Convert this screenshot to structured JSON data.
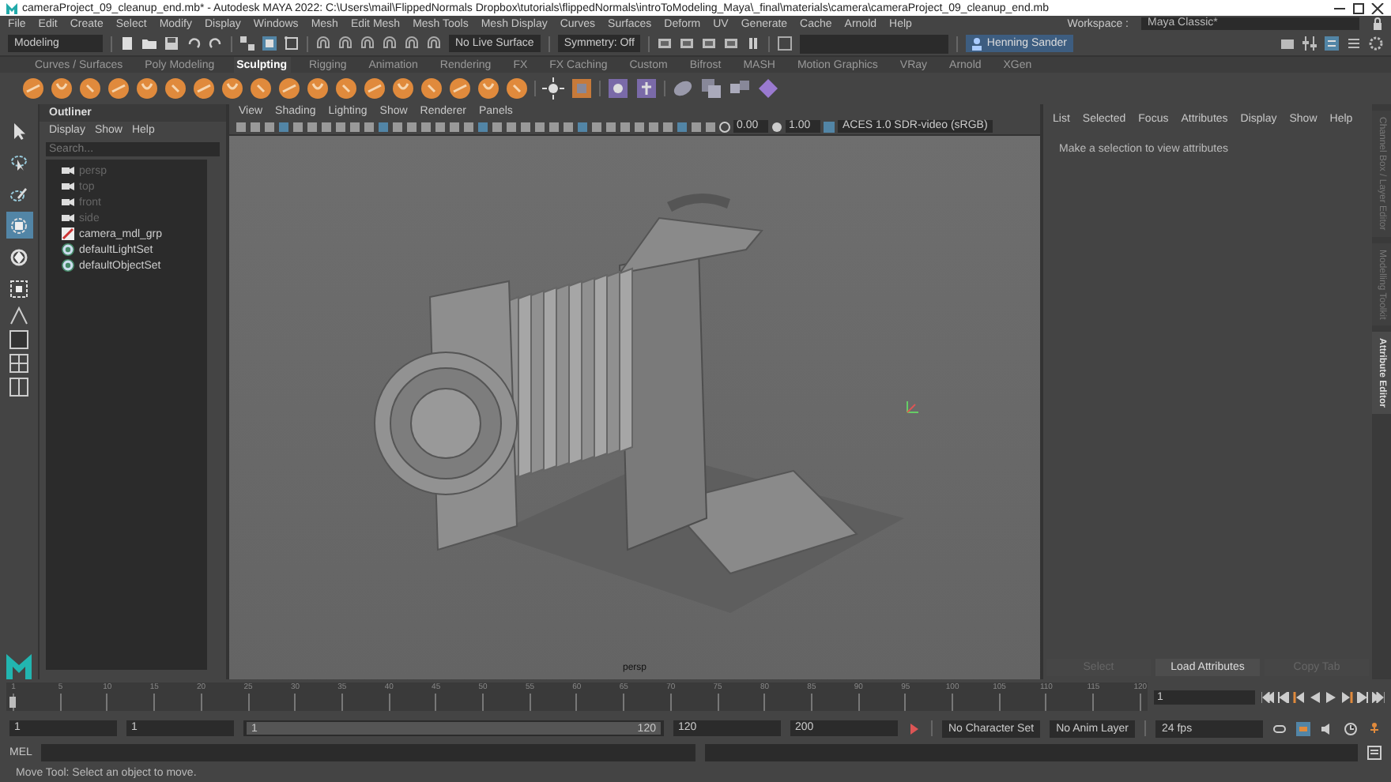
{
  "window": {
    "title": "cameraProject_09_cleanup_end.mb* - Autodesk MAYA 2022: C:\\Users\\mail\\FlippedNormals Dropbox\\tutorials\\flippedNormals\\introToModeling_Maya\\_final\\materials\\camera\\cameraProject_09_cleanup_end.mb"
  },
  "menu_bar": [
    "File",
    "Edit",
    "Create",
    "Select",
    "Modify",
    "Display",
    "Windows",
    "Mesh",
    "Edit Mesh",
    "Mesh Tools",
    "Mesh Display",
    "Curves",
    "Surfaces",
    "Deform",
    "UV",
    "Generate",
    "Cache",
    "Arnold",
    "Help"
  ],
  "workspace": {
    "label": "Workspace :",
    "value": "Maya Classic*"
  },
  "status_line": {
    "menu_set": "Modeling",
    "live_surface": "No Live Surface",
    "symmetry": "Symmetry: Off",
    "user": "Henning Sander"
  },
  "shelf_tabs": [
    {
      "label": "Curves / Surfaces",
      "selected": false
    },
    {
      "label": "Poly Modeling",
      "selected": false
    },
    {
      "label": "Sculpting",
      "selected": true
    },
    {
      "label": "Rigging",
      "selected": false
    },
    {
      "label": "Animation",
      "selected": false
    },
    {
      "label": "Rendering",
      "selected": false
    },
    {
      "label": "FX",
      "selected": false
    },
    {
      "label": "FX Caching",
      "selected": false
    },
    {
      "label": "Custom",
      "selected": false
    },
    {
      "label": "Bifrost",
      "selected": false
    },
    {
      "label": "MASH",
      "selected": false
    },
    {
      "label": "Motion Graphics",
      "selected": false
    },
    {
      "label": "VRay",
      "selected": false
    },
    {
      "label": "Arnold",
      "selected": false
    },
    {
      "label": "XGen",
      "selected": false
    }
  ],
  "toolbox": [
    {
      "kind": "select",
      "selected": false
    },
    {
      "kind": "lasso",
      "selected": false
    },
    {
      "kind": "paint",
      "selected": false
    },
    {
      "kind": "move",
      "selected": true
    },
    {
      "kind": "rotate",
      "selected": false
    },
    {
      "kind": "scale",
      "selected": false
    }
  ],
  "outliner": {
    "title": "Outliner",
    "menus": [
      "Display",
      "Show",
      "Help"
    ],
    "search": {
      "placeholder": "Search..."
    },
    "items": [
      {
        "kind": "camera",
        "label": "persp",
        "hidden": true
      },
      {
        "kind": "camera",
        "label": "top",
        "hidden": true
      },
      {
        "kind": "camera",
        "label": "front",
        "hidden": true
      },
      {
        "kind": "camera",
        "label": "side",
        "hidden": true
      },
      {
        "kind": "group",
        "label": "camera_mdl_grp",
        "hidden": false
      },
      {
        "kind": "set",
        "label": "defaultLightSet",
        "hidden": false
      },
      {
        "kind": "set",
        "label": "defaultObjectSet",
        "hidden": false
      }
    ]
  },
  "viewport": {
    "menus": [
      "View",
      "Shading",
      "Lighting",
      "Show",
      "Renderer",
      "Panels"
    ],
    "exposure": "0.00",
    "gamma": "1.00",
    "color_space": "ACES 1.0 SDR-video (sRGB)",
    "camera_label": "persp"
  },
  "attribute_editor": {
    "menus": [
      "List",
      "Selected",
      "Focus",
      "Attributes",
      "Display",
      "Show",
      "Help"
    ],
    "message": "Make a selection to view attributes",
    "buttons": [
      {
        "label": "Select",
        "disabled": true
      },
      {
        "label": "Load Attributes",
        "disabled": false
      },
      {
        "label": "Copy Tab",
        "disabled": true
      }
    ],
    "side_tabs": [
      {
        "label": "Channel Box / Layer Editor",
        "selected": false
      },
      {
        "label": "Modelling Toolkit",
        "selected": false
      },
      {
        "label": "Attribute Editor",
        "selected": true
      }
    ]
  },
  "timeline": {
    "ticks": [
      "1",
      "5",
      "10",
      "15",
      "20",
      "25",
      "30",
      "35",
      "40",
      "45",
      "50",
      "55",
      "60",
      "65",
      "70",
      "75",
      "80",
      "85",
      "90",
      "95",
      "100",
      "105",
      "110",
      "115",
      "120"
    ],
    "current_frame": "1",
    "level": 0
  },
  "range": {
    "start": "1",
    "playback_start": "1",
    "slider_start": "1",
    "slider_end": "120",
    "level": 1,
    "playback_end": "120",
    "end": "200",
    "character_set": "No Character Set",
    "anim_layer": "No Anim Layer",
    "fps": "24 fps"
  },
  "command_line": {
    "label": "MEL"
  },
  "help_line": "Move Tool: Select an object to move."
}
